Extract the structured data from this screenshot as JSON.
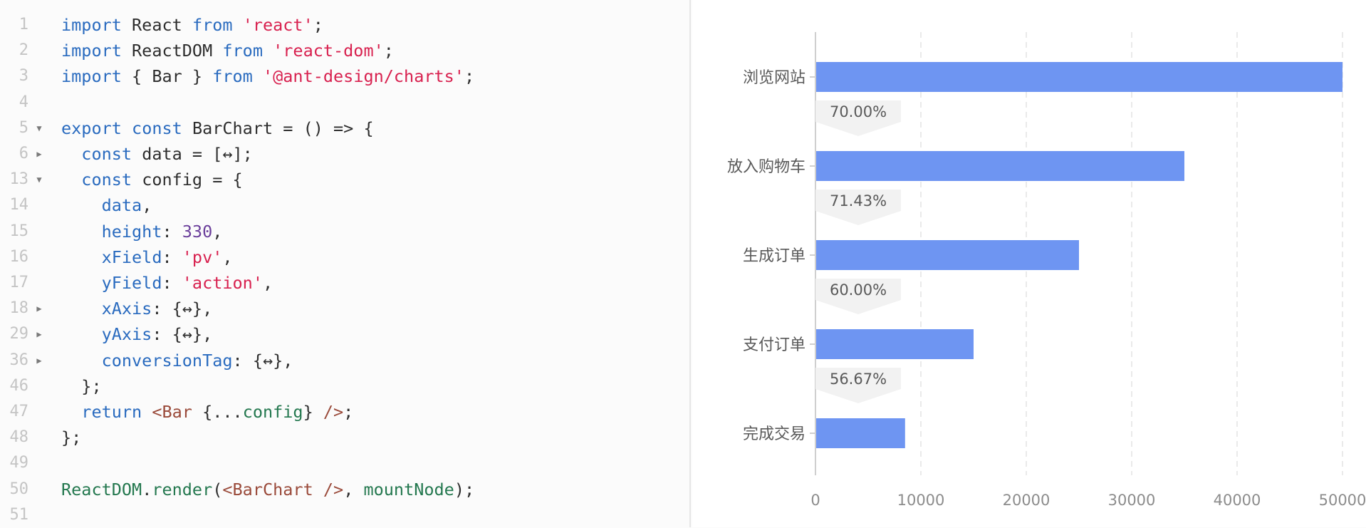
{
  "editor": {
    "lines": [
      {
        "num": "1",
        "fold": "",
        "tokens": [
          {
            "t": "import",
            "c": "kw"
          },
          {
            "t": " React ",
            "c": "plain"
          },
          {
            "t": "from",
            "c": "kw"
          },
          {
            "t": " ",
            "c": "plain"
          },
          {
            "t": "'react'",
            "c": "str"
          },
          {
            "t": ";",
            "c": "plain"
          }
        ]
      },
      {
        "num": "2",
        "fold": "",
        "tokens": [
          {
            "t": "import",
            "c": "kw"
          },
          {
            "t": " ReactDOM ",
            "c": "plain"
          },
          {
            "t": "from",
            "c": "kw"
          },
          {
            "t": " ",
            "c": "plain"
          },
          {
            "t": "'react-dom'",
            "c": "str"
          },
          {
            "t": ";",
            "c": "plain"
          }
        ]
      },
      {
        "num": "3",
        "fold": "",
        "tokens": [
          {
            "t": "import",
            "c": "kw"
          },
          {
            "t": " { Bar } ",
            "c": "plain"
          },
          {
            "t": "from",
            "c": "kw"
          },
          {
            "t": " ",
            "c": "plain"
          },
          {
            "t": "'@ant-design/charts'",
            "c": "str"
          },
          {
            "t": ";",
            "c": "plain"
          }
        ]
      },
      {
        "num": "4",
        "fold": "",
        "tokens": []
      },
      {
        "num": "5",
        "fold": "open",
        "tokens": [
          {
            "t": "export",
            "c": "kw"
          },
          {
            "t": " ",
            "c": "plain"
          },
          {
            "t": "const",
            "c": "kw"
          },
          {
            "t": " BarChart = () => {",
            "c": "plain"
          }
        ]
      },
      {
        "num": "6",
        "fold": "closed",
        "tokens": [
          {
            "t": "  ",
            "c": "plain"
          },
          {
            "t": "const",
            "c": "kw"
          },
          {
            "t": " data = [↔];",
            "c": "plain"
          }
        ]
      },
      {
        "num": "13",
        "fold": "open",
        "tokens": [
          {
            "t": "  ",
            "c": "plain"
          },
          {
            "t": "const",
            "c": "kw"
          },
          {
            "t": " config = {",
            "c": "plain"
          }
        ]
      },
      {
        "num": "14",
        "fold": "",
        "tokens": [
          {
            "t": "    ",
            "c": "plain"
          },
          {
            "t": "data",
            "c": "prop"
          },
          {
            "t": ",",
            "c": "plain"
          }
        ]
      },
      {
        "num": "15",
        "fold": "",
        "tokens": [
          {
            "t": "    ",
            "c": "plain"
          },
          {
            "t": "height",
            "c": "prop"
          },
          {
            "t": ": ",
            "c": "plain"
          },
          {
            "t": "330",
            "c": "num"
          },
          {
            "t": ",",
            "c": "plain"
          }
        ]
      },
      {
        "num": "16",
        "fold": "",
        "tokens": [
          {
            "t": "    ",
            "c": "plain"
          },
          {
            "t": "xField",
            "c": "prop"
          },
          {
            "t": ": ",
            "c": "plain"
          },
          {
            "t": "'pv'",
            "c": "str"
          },
          {
            "t": ",",
            "c": "plain"
          }
        ]
      },
      {
        "num": "17",
        "fold": "",
        "tokens": [
          {
            "t": "    ",
            "c": "plain"
          },
          {
            "t": "yField",
            "c": "prop"
          },
          {
            "t": ": ",
            "c": "plain"
          },
          {
            "t": "'action'",
            "c": "str"
          },
          {
            "t": ",",
            "c": "plain"
          }
        ]
      },
      {
        "num": "18",
        "fold": "closed",
        "tokens": [
          {
            "t": "    ",
            "c": "plain"
          },
          {
            "t": "xAxis",
            "c": "prop"
          },
          {
            "t": ": {↔},",
            "c": "plain"
          }
        ]
      },
      {
        "num": "29",
        "fold": "closed",
        "tokens": [
          {
            "t": "    ",
            "c": "plain"
          },
          {
            "t": "yAxis",
            "c": "prop"
          },
          {
            "t": ": {↔},",
            "c": "plain"
          }
        ]
      },
      {
        "num": "36",
        "fold": "closed",
        "tokens": [
          {
            "t": "    ",
            "c": "plain"
          },
          {
            "t": "conversionTag",
            "c": "prop"
          },
          {
            "t": ": {↔},",
            "c": "plain"
          }
        ]
      },
      {
        "num": "46",
        "fold": "",
        "tokens": [
          {
            "t": "  };",
            "c": "plain"
          }
        ]
      },
      {
        "num": "47",
        "fold": "",
        "tokens": [
          {
            "t": "  ",
            "c": "plain"
          },
          {
            "t": "return",
            "c": "kw"
          },
          {
            "t": " ",
            "c": "plain"
          },
          {
            "t": "<Bar",
            "c": "tag"
          },
          {
            "t": " {...",
            "c": "plain"
          },
          {
            "t": "config",
            "c": "fn"
          },
          {
            "t": "} ",
            "c": "plain"
          },
          {
            "t": "/>",
            "c": "tag"
          },
          {
            "t": ";",
            "c": "plain"
          }
        ]
      },
      {
        "num": "48",
        "fold": "",
        "tokens": [
          {
            "t": "};",
            "c": "plain"
          }
        ]
      },
      {
        "num": "49",
        "fold": "",
        "tokens": []
      },
      {
        "num": "50",
        "fold": "",
        "tokens": [
          {
            "t": "ReactDOM",
            "c": "fn"
          },
          {
            "t": ".",
            "c": "plain"
          },
          {
            "t": "render",
            "c": "fn"
          },
          {
            "t": "(",
            "c": "plain"
          },
          {
            "t": "<BarChart",
            "c": "tag"
          },
          {
            "t": " ",
            "c": "plain"
          },
          {
            "t": "/>",
            "c": "tag"
          },
          {
            "t": ", ",
            "c": "plain"
          },
          {
            "t": "mountNode",
            "c": "fn"
          },
          {
            "t": ");",
            "c": "plain"
          }
        ]
      },
      {
        "num": "51",
        "fold": "",
        "tokens": []
      }
    ]
  },
  "chart_data": {
    "type": "bar",
    "orientation": "horizontal",
    "categories": [
      "浏览网站",
      "放入购物车",
      "生成订单",
      "支付订单",
      "完成交易"
    ],
    "values": [
      50000,
      35000,
      25000,
      15000,
      8500
    ],
    "conversion_rates": [
      "70.00%",
      "71.43%",
      "60.00%",
      "56.67%"
    ],
    "x_ticks": [
      "0",
      "10000",
      "20000",
      "30000",
      "40000",
      "50000"
    ],
    "xlim": [
      0,
      50000
    ],
    "grid": "vertical dashed",
    "bar_color": "#6e95f2"
  }
}
